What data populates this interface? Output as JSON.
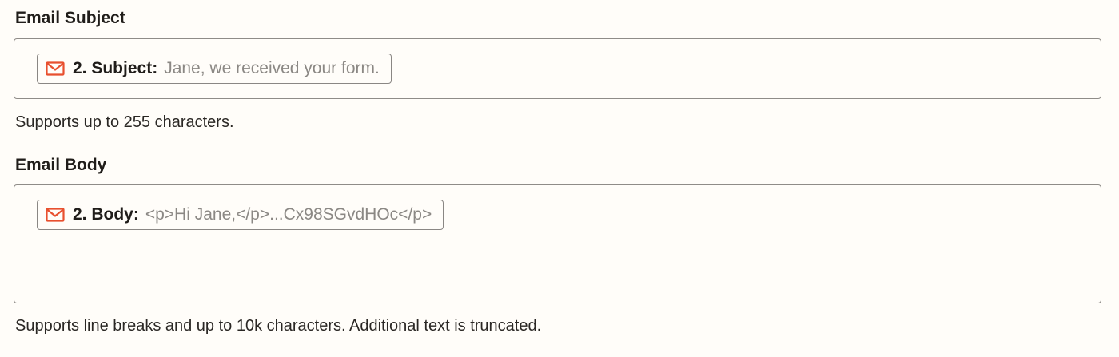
{
  "subject_field": {
    "label": "Email Subject",
    "token": {
      "icon": "mail-icon",
      "key": "2. Subject:",
      "value": "Jane, we received your form."
    },
    "help": "Supports up to 255 characters."
  },
  "body_field": {
    "label": "Email Body",
    "token": {
      "icon": "mail-icon",
      "key": "2. Body:",
      "value": "<p>Hi Jane,</p>...Cx98SGvdHOc</p>"
    },
    "help": "Supports line breaks and up to 10k characters. Additional text is truncated."
  },
  "colors": {
    "icon_accent": "#e8502f",
    "background": "#fffdf9",
    "border": "#8f8c88",
    "placeholder_text": "#8b8884"
  }
}
